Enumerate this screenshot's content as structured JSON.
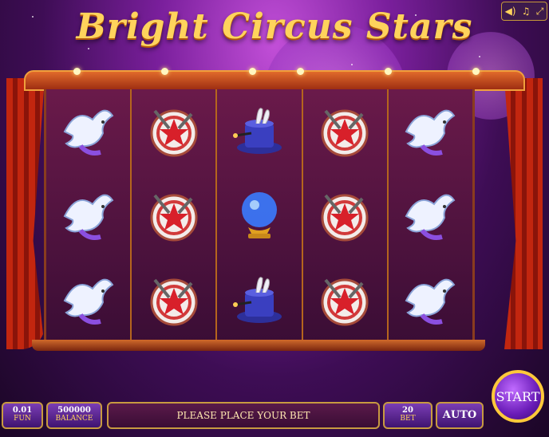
{
  "title": "Bright Circus Stars",
  "system_buttons": {
    "sound_icon": "speaker-icon",
    "music_icon": "music-note-icon",
    "fullscreen_icon": "fullscreen-icon"
  },
  "reels": [
    [
      "dove",
      "dove",
      "dove"
    ],
    [
      "target",
      "target",
      "target"
    ],
    [
      "magic-hat",
      "crystal-ball",
      "magic-hat"
    ],
    [
      "target",
      "target",
      "target"
    ],
    [
      "dove",
      "dove",
      "dove"
    ]
  ],
  "controls": {
    "coin_value": "0.01",
    "coin_label": "FUN",
    "balance_value": "500000",
    "balance_label": "BALANCE",
    "message": "PLEASE PLACE YOUR BET",
    "bet_value": "20",
    "bet_label": "BET",
    "auto_label": "AUTO",
    "start_label": "START"
  },
  "colors": {
    "accent": "#ffd35c",
    "button": "#7b3db5",
    "frame": "#e16a2b"
  }
}
